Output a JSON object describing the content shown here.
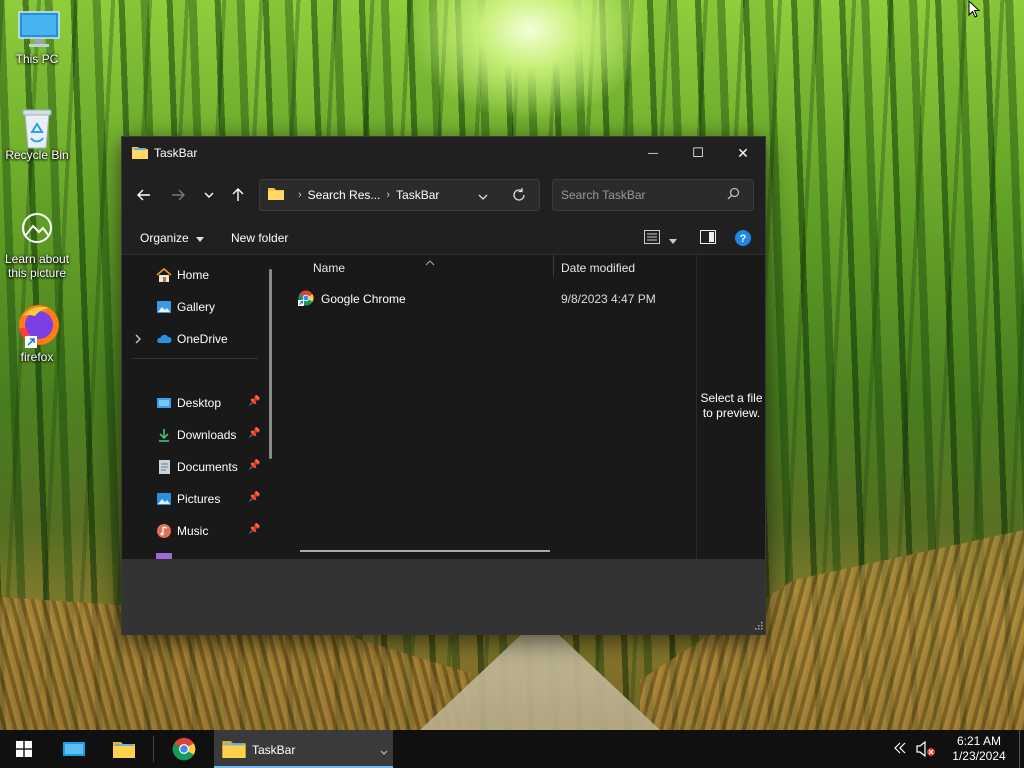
{
  "desktop": {
    "icons": [
      {
        "label": "This PC"
      },
      {
        "label": "Recycle Bin"
      },
      {
        "label": "Learn about this picture"
      },
      {
        "label": "firefox"
      }
    ]
  },
  "window": {
    "title": "TaskBar",
    "controls": {
      "minimize": "—",
      "maximize": "☐",
      "close": "✕"
    },
    "address": {
      "crumbs": [
        "Search Res...",
        "TaskBar"
      ]
    },
    "search": {
      "placeholder": "Search TaskBar"
    },
    "commands": {
      "organize": "Organize",
      "new_folder": "New folder"
    },
    "nav": {
      "home": "Home",
      "gallery": "Gallery",
      "onedrive": "OneDrive",
      "desktop": "Desktop",
      "downloads": "Downloads",
      "documents": "Documents",
      "pictures": "Pictures",
      "music": "Music"
    },
    "columns": {
      "name": "Name",
      "date_modified": "Date modified"
    },
    "files": [
      {
        "name": "Google Chrome",
        "date_modified": "9/8/2023 4:47 PM"
      }
    ],
    "preview_text": "Select a file to preview."
  },
  "taskbar": {
    "active_window_label": "TaskBar",
    "clock": {
      "time": "6:21 AM",
      "date": "1/23/2024"
    }
  },
  "colors": {
    "accent": "#76b9ed",
    "window_bg": "#191919",
    "chrome_bg": "#202020",
    "status_bg": "#333333"
  }
}
